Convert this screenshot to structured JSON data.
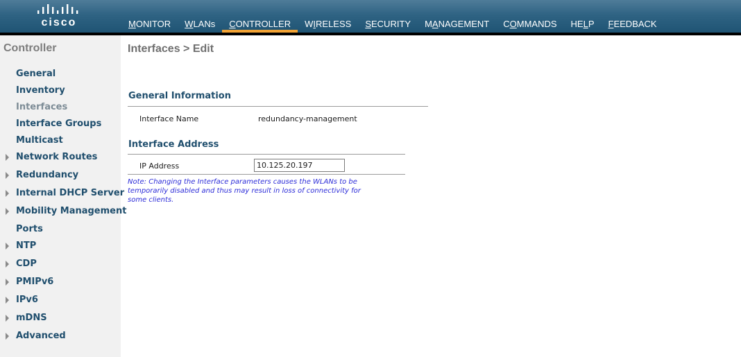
{
  "brand": {
    "logo_text": "cisco"
  },
  "nav": {
    "items": [
      {
        "label": "MONITOR",
        "ul": "M",
        "rest": "ONITOR"
      },
      {
        "label": "WLANs",
        "ul": "W",
        "rest": "LANs"
      },
      {
        "label": "CONTROLLER",
        "ul": "C",
        "rest": "ONTROLLER"
      },
      {
        "label": "WIRELESS",
        "ul": "",
        "pre": "W",
        "mid": "I",
        "post": "RELESS"
      },
      {
        "label": "SECURITY",
        "ul": "S",
        "rest": "ECURITY"
      },
      {
        "label": "MANAGEMENT",
        "pre": "M",
        "mid": "A",
        "post": "NAGEMENT"
      },
      {
        "label": "COMMANDS",
        "pre": "C",
        "mid": "O",
        "post": "MMANDS"
      },
      {
        "label": "HELP",
        "pre": "HE",
        "mid": "L",
        "post": "P"
      },
      {
        "label": "FEEDBACK",
        "ul": "F",
        "rest": "EEDBACK"
      }
    ],
    "active": "CONTROLLER",
    "accent_color": "#f2a335"
  },
  "sidebar": {
    "title": "Controller",
    "items": [
      {
        "label": "General",
        "expandable": false
      },
      {
        "label": "Inventory",
        "expandable": false
      },
      {
        "label": "Interfaces",
        "expandable": false,
        "current": true
      },
      {
        "label": "Interface Groups",
        "expandable": false
      },
      {
        "label": "Multicast",
        "expandable": false
      },
      {
        "label": "Network Routes",
        "expandable": true
      },
      {
        "label": "Redundancy",
        "expandable": true
      },
      {
        "label": "Internal DHCP Server",
        "expandable": true
      },
      {
        "label": "Mobility Management",
        "expandable": true
      },
      {
        "label": "Ports",
        "expandable": false
      },
      {
        "label": "NTP",
        "expandable": true
      },
      {
        "label": "CDP",
        "expandable": true
      },
      {
        "label": "PMIPv6",
        "expandable": true
      },
      {
        "label": "IPv6",
        "expandable": true
      },
      {
        "label": "mDNS",
        "expandable": true
      },
      {
        "label": "Advanced",
        "expandable": true
      }
    ]
  },
  "main": {
    "title": "Interfaces > Edit",
    "general_info": {
      "heading": "General Information",
      "interface_name_label": "Interface Name",
      "interface_name_value": "redundancy-management"
    },
    "interface_address": {
      "heading": "Interface Address",
      "ip_label": "IP Address",
      "ip_value": "10.125.20.197"
    },
    "note_lines": [
      "Note: Changing the Interface parameters causes the WLANs to be",
      "temporarily disabled and thus may result in loss of connectivity for",
      "some clients."
    ]
  }
}
